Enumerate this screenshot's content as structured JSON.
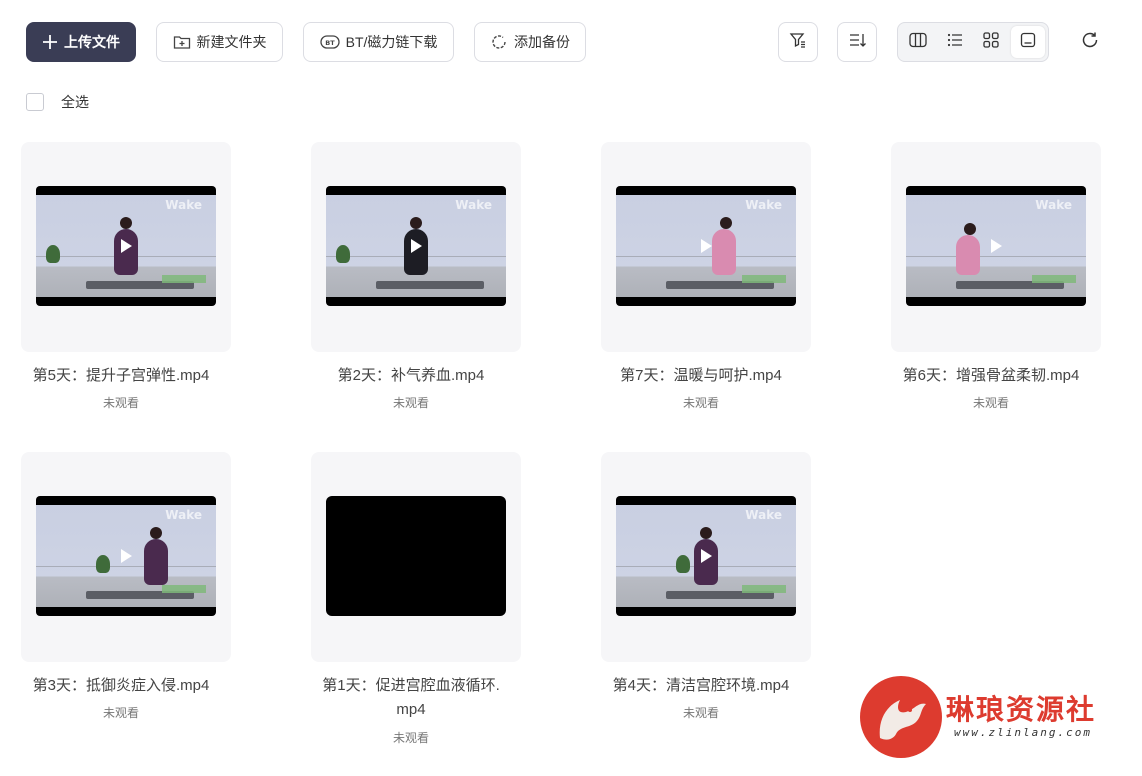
{
  "toolbar": {
    "upload_label": "上传文件",
    "new_folder_label": "新建文件夹",
    "bt_label": "BT/磁力链下载",
    "backup_label": "添加备份"
  },
  "select_all_label": "全选",
  "files": [
    {
      "name": "第5天：提升子宫弹性.mp4",
      "status": "未观看",
      "brand": "Wake"
    },
    {
      "name": "第2天：补气养血.mp4",
      "status": "未观看",
      "brand": "Wake"
    },
    {
      "name": "第7天：温暖与呵护.mp4",
      "status": "未观看",
      "brand": "Wake"
    },
    {
      "name": "第6天：增强骨盆柔韧.mp4",
      "status": "未观看",
      "brand": "Wake"
    },
    {
      "name": "第3天：抵御炎症入侵.mp4",
      "status": "未观看",
      "brand": "Wake"
    },
    {
      "name_line1": "第1天：促进宫腔血液循环.",
      "name_line2": "mp4",
      "status": "未观看"
    },
    {
      "name": "第4天：清洁宫腔环境.mp4",
      "status": "未观看",
      "brand": "Wake"
    }
  ],
  "watermark": {
    "title": "琳琅资源社",
    "url": "www.zlinlang.com"
  },
  "colors": {
    "primary": "#3a3d55",
    "watermark_red": "#dd3b2f"
  }
}
